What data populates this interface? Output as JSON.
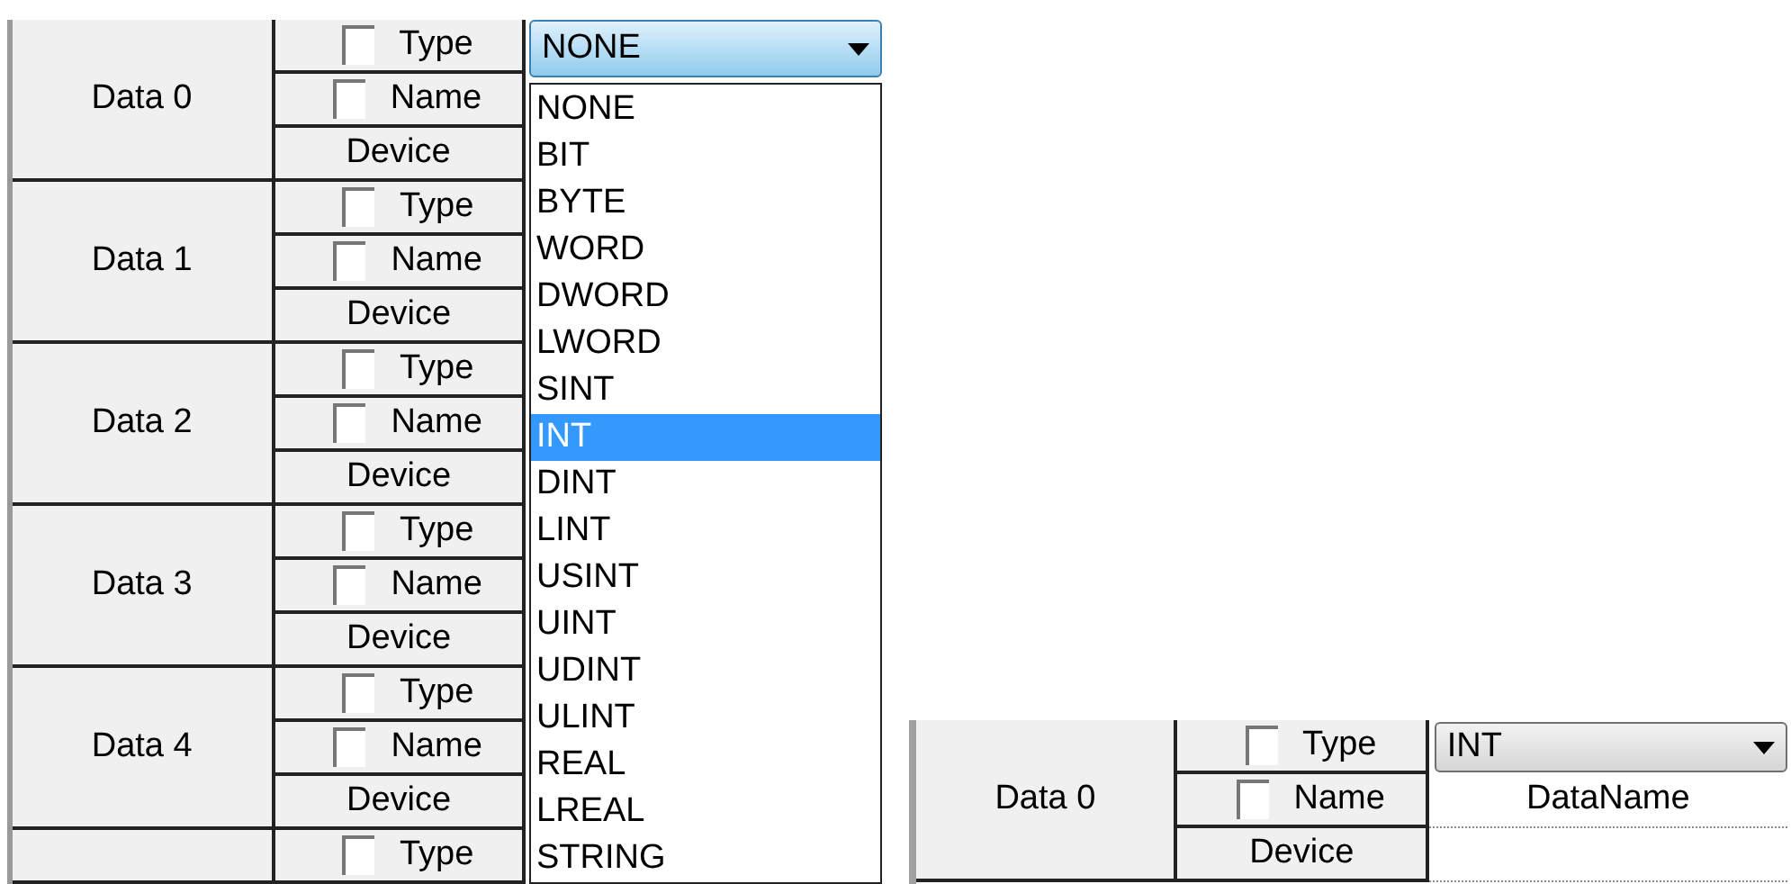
{
  "left_panel": {
    "groups": [
      {
        "label": "Data 0",
        "rows": [
          {
            "kind": "checkbox",
            "label": "Type",
            "checked": false
          },
          {
            "kind": "checkbox",
            "label": "Name",
            "checked": false
          },
          {
            "kind": "plain",
            "label": "Device"
          }
        ]
      },
      {
        "label": "Data 1",
        "rows": [
          {
            "kind": "checkbox",
            "label": "Type",
            "checked": false
          },
          {
            "kind": "checkbox",
            "label": "Name",
            "checked": false
          },
          {
            "kind": "plain",
            "label": "Device"
          }
        ]
      },
      {
        "label": "Data 2",
        "rows": [
          {
            "kind": "checkbox",
            "label": "Type",
            "checked": false
          },
          {
            "kind": "checkbox",
            "label": "Name",
            "checked": false
          },
          {
            "kind": "plain",
            "label": "Device"
          }
        ]
      },
      {
        "label": "Data 3",
        "rows": [
          {
            "kind": "checkbox",
            "label": "Type",
            "checked": false
          },
          {
            "kind": "checkbox",
            "label": "Name",
            "checked": false
          },
          {
            "kind": "plain",
            "label": "Device"
          }
        ]
      },
      {
        "label": "Data 4",
        "rows": [
          {
            "kind": "checkbox",
            "label": "Type",
            "checked": false
          },
          {
            "kind": "checkbox",
            "label": "Name",
            "checked": false
          },
          {
            "kind": "plain",
            "label": "Device"
          }
        ]
      },
      {
        "rows": [
          {
            "kind": "checkbox",
            "label": "Type",
            "checked": false
          }
        ]
      }
    ],
    "dropdown": {
      "value": "NONE",
      "expanded": true,
      "options": [
        {
          "label": "NONE",
          "highlighted": false
        },
        {
          "label": "BIT",
          "highlighted": false
        },
        {
          "label": "BYTE",
          "highlighted": false
        },
        {
          "label": "WORD",
          "highlighted": false
        },
        {
          "label": "DWORD",
          "highlighted": false
        },
        {
          "label": "LWORD",
          "highlighted": false
        },
        {
          "label": "SINT",
          "highlighted": false
        },
        {
          "label": "INT",
          "highlighted": true
        },
        {
          "label": "DINT",
          "highlighted": false
        },
        {
          "label": "LINT",
          "highlighted": false
        },
        {
          "label": "USINT",
          "highlighted": false
        },
        {
          "label": "UINT",
          "highlighted": false
        },
        {
          "label": "UDINT",
          "highlighted": false
        },
        {
          "label": "ULINT",
          "highlighted": false
        },
        {
          "label": "REAL",
          "highlighted": false
        },
        {
          "label": "LREAL",
          "highlighted": false
        },
        {
          "label": "STRING",
          "highlighted": false
        }
      ]
    }
  },
  "right_panel": {
    "group": {
      "label": "Data 0",
      "rows": [
        {
          "kind": "checkbox",
          "label": "Type",
          "checked": false,
          "value": "INT"
        },
        {
          "kind": "checkbox",
          "label": "Name",
          "checked": false,
          "value": "DataName"
        },
        {
          "kind": "plain",
          "label": "Device"
        }
      ]
    }
  }
}
